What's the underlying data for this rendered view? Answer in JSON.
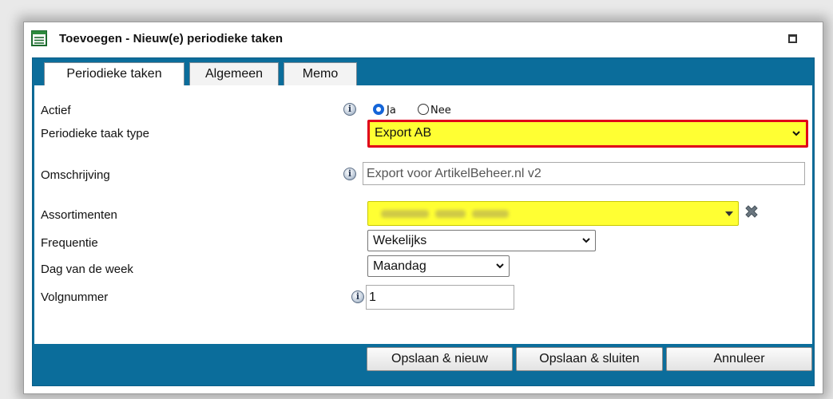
{
  "window": {
    "title": "Toevoegen - Nieuw(e) periodieke taken"
  },
  "tabs": [
    {
      "label": "Periodieke taken",
      "active": true
    },
    {
      "label": "Algemeen",
      "active": false
    },
    {
      "label": "Memo",
      "active": false
    }
  ],
  "form": {
    "actief": {
      "label": "Actief",
      "options": [
        {
          "label": "Ja",
          "checked": true
        },
        {
          "label": "Nee",
          "checked": false
        }
      ]
    },
    "taak_type": {
      "label": "Periodieke taak type",
      "value": "Export AB"
    },
    "omschrijving": {
      "label": "Omschrijving",
      "value": "Export voor ArtikelBeheer.nl v2"
    },
    "assortimenten": {
      "label": "Assortimenten",
      "value": ""
    },
    "frequentie": {
      "label": "Frequentie",
      "value": "Wekelijks"
    },
    "dag": {
      "label": "Dag van de week",
      "value": "Maandag"
    },
    "volgnummer": {
      "label": "Volgnummer",
      "value": "1"
    }
  },
  "buttons": {
    "save_new": "Opslaan & nieuw",
    "save_close": "Opslaan & sluiten",
    "cancel": "Annuleer"
  },
  "colors": {
    "panel_blue": "#0b6d9b",
    "highlight_yellow": "#ffff33",
    "highlight_red": "#e0001a"
  },
  "icons": [
    "form-icon",
    "maximize-icon",
    "info-icon",
    "chevron-down-icon",
    "remove-icon"
  ]
}
